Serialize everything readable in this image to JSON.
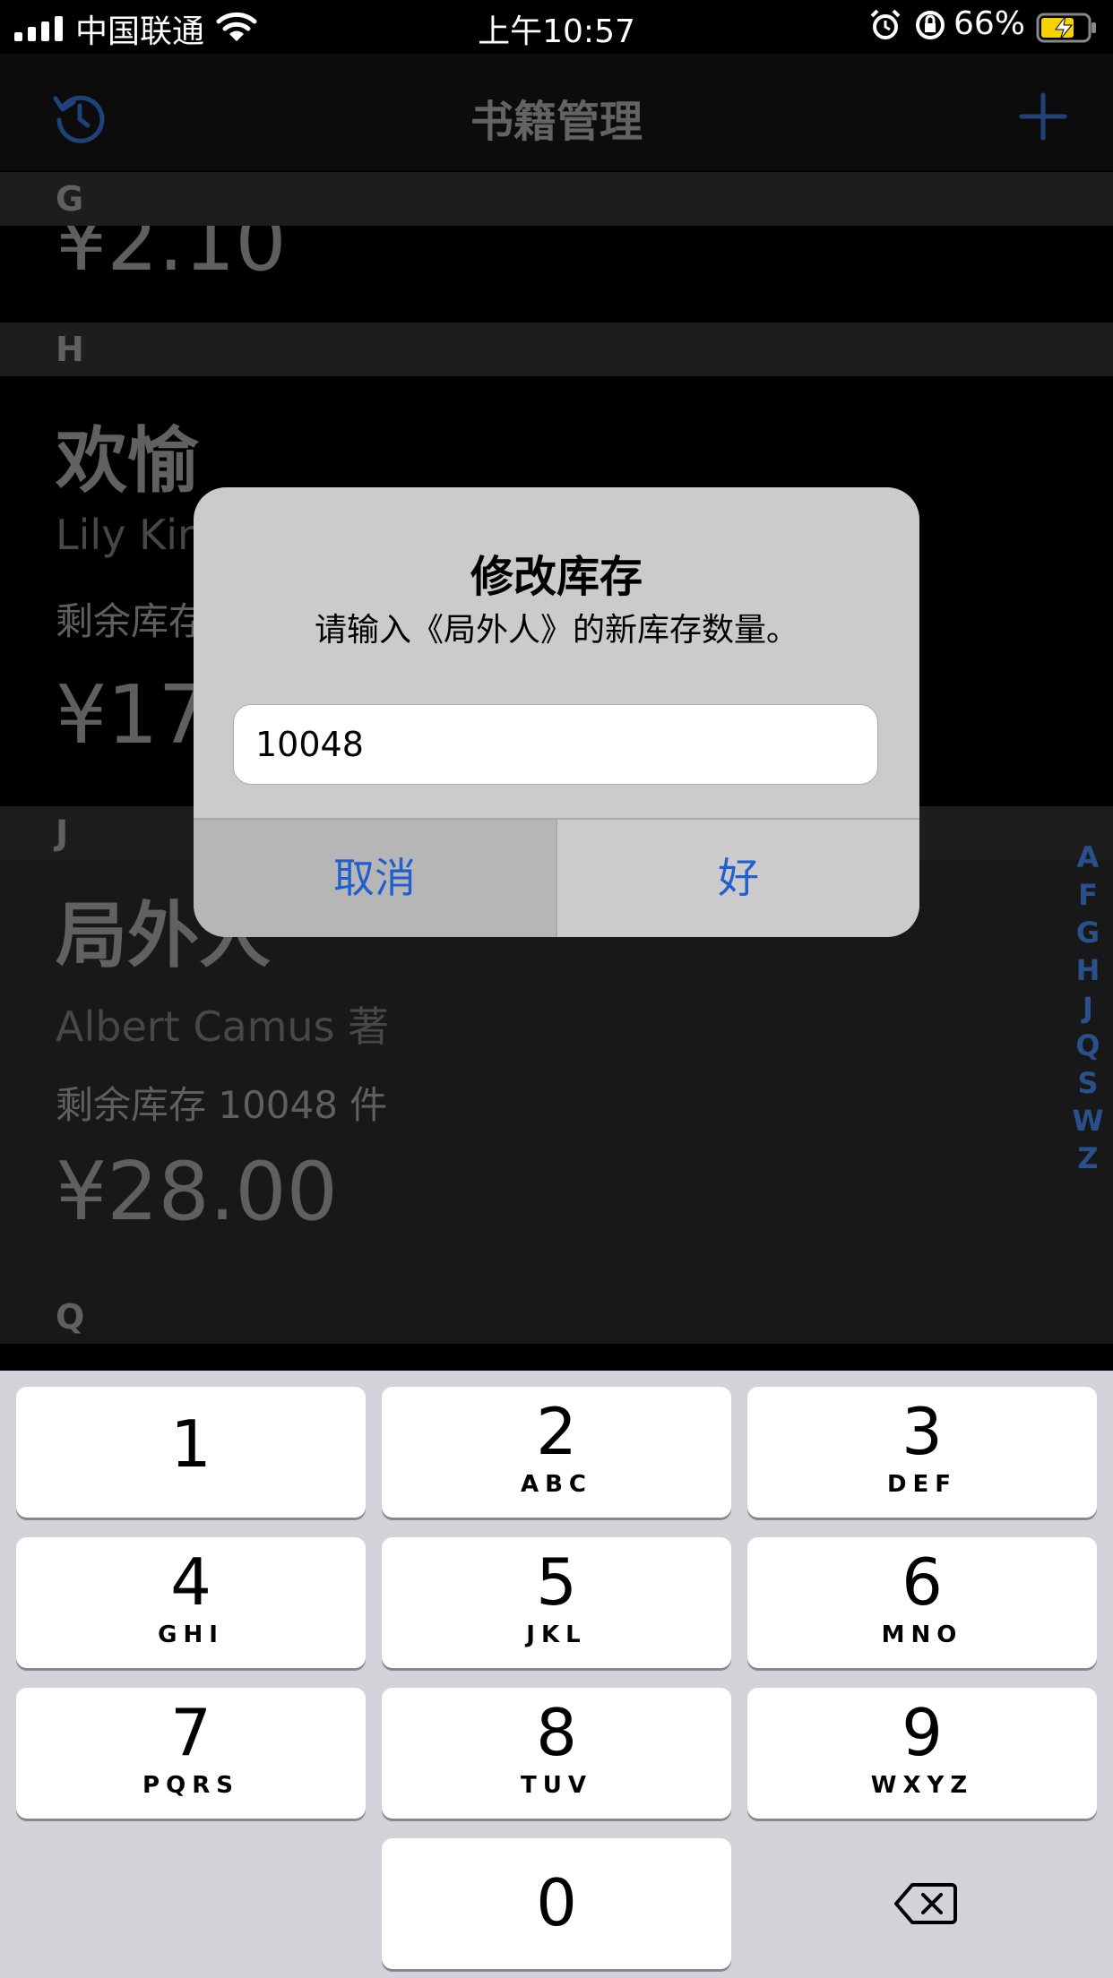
{
  "status_bar": {
    "carrier": "中国联通",
    "time": "上午10:57",
    "battery_percent": "66%"
  },
  "nav_bar": {
    "title": "书籍管理",
    "left_icon": "history-icon",
    "right_icon": "add-icon"
  },
  "list": {
    "sections": [
      {
        "letter": "G",
        "price_partial": "¥2.10"
      },
      {
        "letter": "H",
        "title": "欢愉",
        "author_partial": "Lily Kin",
        "stock_partial": "剩余库存",
        "price_partial": "¥17."
      },
      {
        "letter": "J",
        "title": "局外人",
        "author": "Albert Camus 著",
        "stock": "剩余库存 10048 件",
        "price": "¥28.00"
      },
      {
        "letter": "Q"
      }
    ],
    "index": [
      "A",
      "F",
      "G",
      "H",
      "J",
      "Q",
      "S",
      "W",
      "Z"
    ]
  },
  "alert": {
    "title": "修改库存",
    "message": "请输入《局外人》的新库存数量。",
    "input_value": "10048",
    "cancel_label": "取消",
    "ok_label": "好"
  },
  "keyboard": {
    "keys": [
      {
        "digit": "1",
        "letters": ""
      },
      {
        "digit": "2",
        "letters": "ABC"
      },
      {
        "digit": "3",
        "letters": "DEF"
      },
      {
        "digit": "4",
        "letters": "GHI"
      },
      {
        "digit": "5",
        "letters": "JKL"
      },
      {
        "digit": "6",
        "letters": "MNO"
      },
      {
        "digit": "7",
        "letters": "PQRS"
      },
      {
        "digit": "8",
        "letters": "TUV"
      },
      {
        "digit": "9",
        "letters": "WXYZ"
      },
      {
        "digit": "0",
        "letters": ""
      }
    ],
    "delete_icon": "delete-icon"
  },
  "colors": {
    "accent": "#1f5fd0",
    "index_blue": "#3b73c8"
  }
}
